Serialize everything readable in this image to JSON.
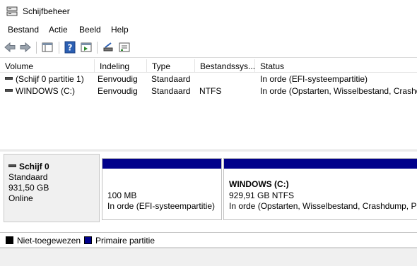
{
  "window": {
    "title": "Schijfbeheer",
    "icon": "disk-management-icon"
  },
  "menubar": {
    "items": [
      "Bestand",
      "Actie",
      "Beeld",
      "Help"
    ]
  },
  "toolbar": {
    "buttons": [
      "back-icon",
      "forward-icon",
      "show-hide-console-tree-icon",
      "help-icon",
      "action-pane-icon",
      "connect-disk-icon",
      "properties-icon"
    ]
  },
  "volume_list": {
    "columns": [
      "Volume",
      "Indeling",
      "Type",
      "Bestandssys...",
      "Status"
    ],
    "rows": [
      {
        "volume": "(Schijf 0 partitie 1)",
        "layout": "Eenvoudig",
        "type": "Standaard",
        "fs": "",
        "status": "In orde (EFI-systeempartitie)"
      },
      {
        "volume": "WINDOWS (C:)",
        "layout": "Eenvoudig",
        "type": "Standaard",
        "fs": "NTFS",
        "status": "In orde (Opstarten, Wisselbestand, Crashdump, Primaire partitie)"
      }
    ]
  },
  "disk": {
    "name": "Schijf 0",
    "type": "Standaard",
    "size": "931,50 GB",
    "state": "Online",
    "partitions": [
      {
        "name": "",
        "size": "100 MB",
        "status": "In orde (EFI-systeempartitie)"
      },
      {
        "name": "WINDOWS  (C:)",
        "size": "929,91 GB NTFS",
        "status": "In orde (Opstarten, Wisselbestand, Crashdump, Primaire partitie)"
      }
    ]
  },
  "legend": [
    {
      "label": "Niet-toegewezen",
      "color": "#000000"
    },
    {
      "label": "Primaire partitie",
      "color": "#00008b"
    }
  ],
  "colors": {
    "partition_bar": "#00008b",
    "unallocated": "#000000"
  }
}
